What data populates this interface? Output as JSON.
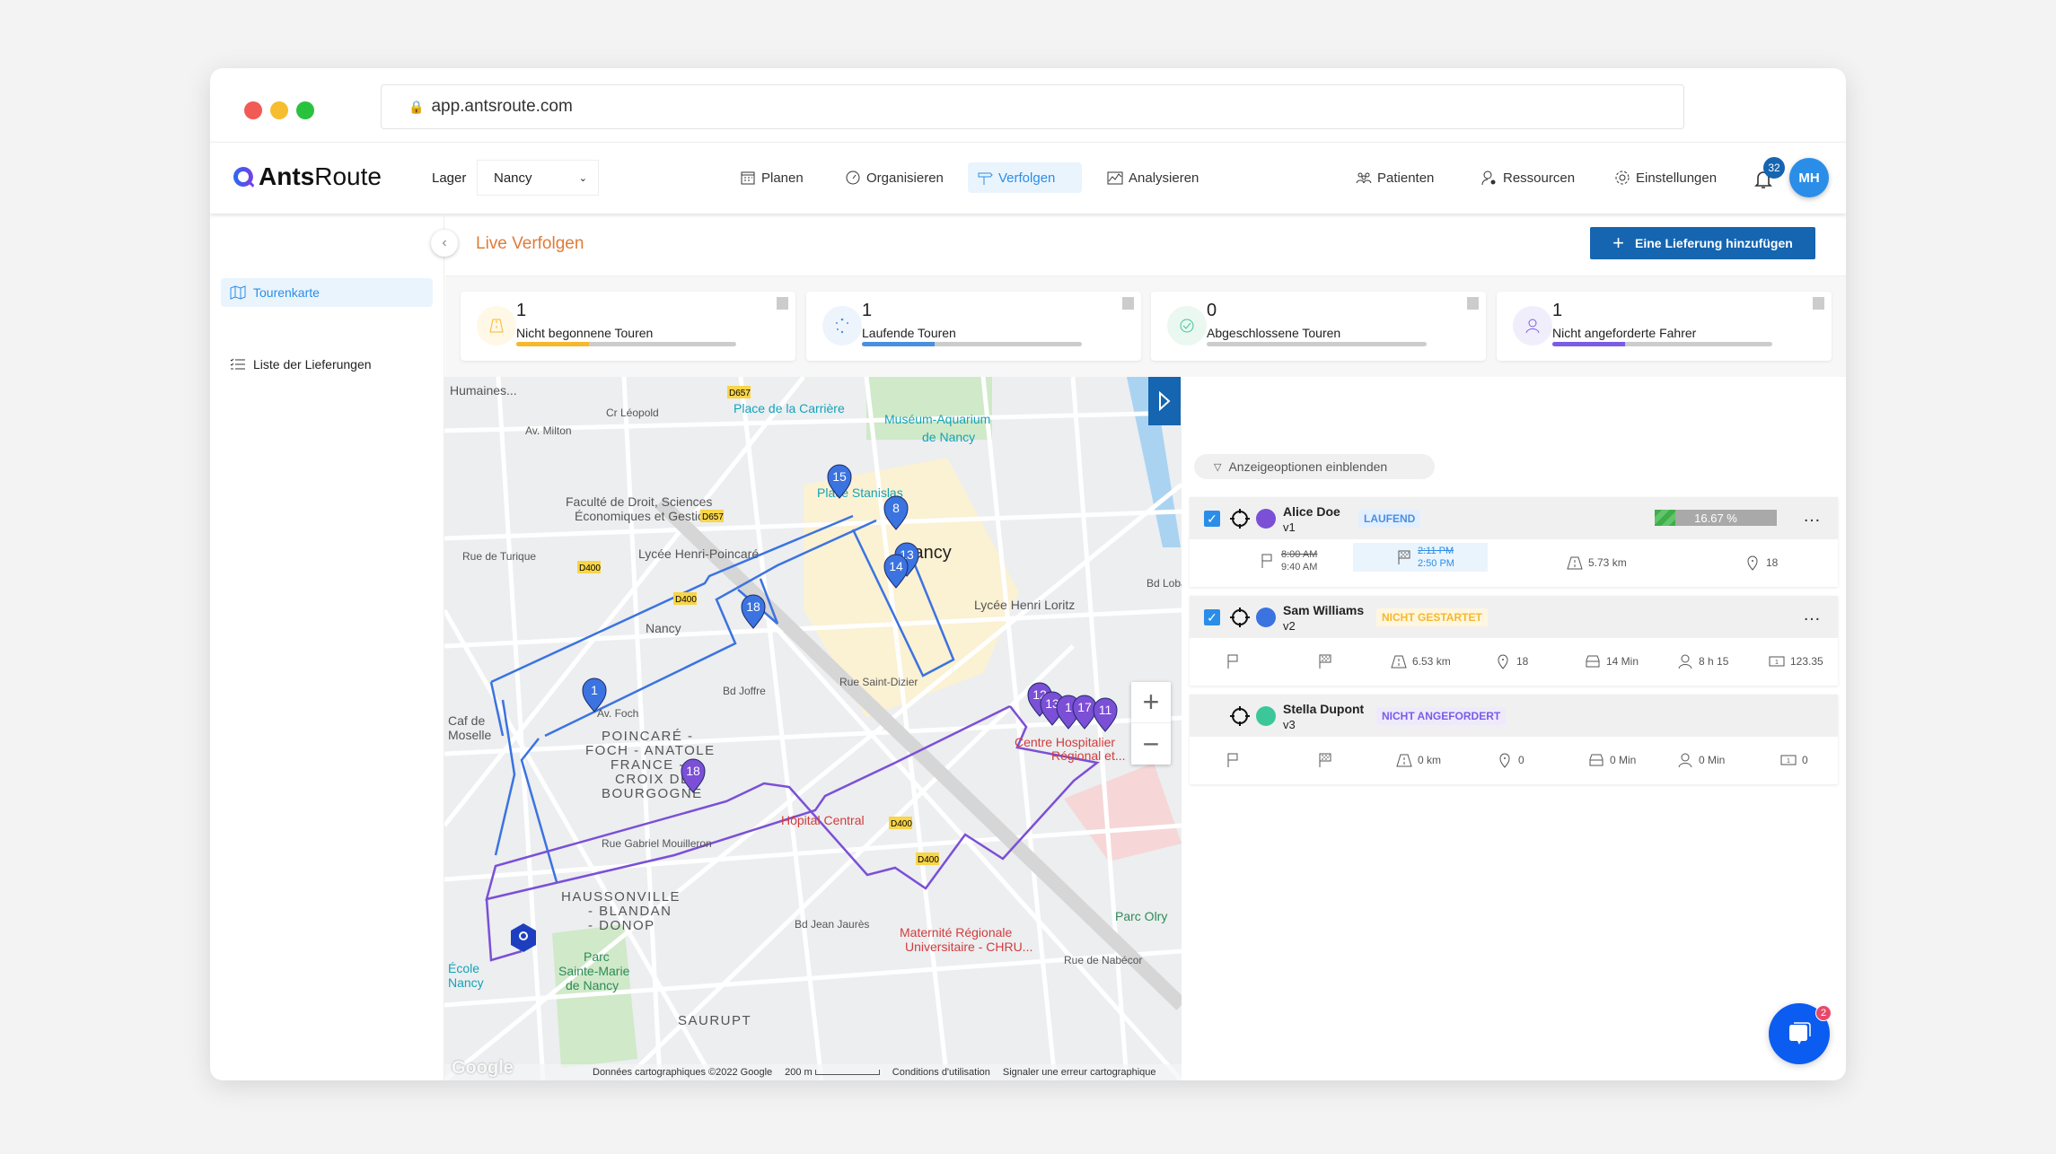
{
  "browser": {
    "url": "app.antsroute.com"
  },
  "header": {
    "logo": {
      "bold": "Ants",
      "light": "Route"
    },
    "lager_label": "Lager",
    "lager_value": "Nancy",
    "nav": [
      {
        "label": "Planen",
        "icon": "calendar-icon"
      },
      {
        "label": "Organisieren",
        "icon": "gauge-icon"
      },
      {
        "label": "Verfolgen",
        "icon": "signpost-icon",
        "active": true
      },
      {
        "label": "Analysieren",
        "icon": "chart-icon"
      }
    ],
    "right_nav": [
      {
        "label": "Patienten",
        "icon": "group-icon"
      },
      {
        "label": "Ressourcen",
        "icon": "user-gear-icon"
      },
      {
        "label": "Einstellungen",
        "icon": "gear-icon"
      }
    ],
    "notifications": "32",
    "avatar": "MH"
  },
  "sidebar": {
    "items": [
      {
        "label": "Tourenkarte",
        "icon": "map-icon",
        "active": true
      },
      {
        "label": "Liste der Lieferungen",
        "icon": "list-icon"
      }
    ]
  },
  "page": {
    "title": "Live Verfolgen",
    "add_button": "Eine Lieferung hinzufügen"
  },
  "colors": {
    "accent": "#1565b0",
    "title": "#e07b39",
    "alice": "#7b4fd6",
    "sam": "#3b73e0",
    "stella": "#3cc79a",
    "laufend_bg": "#e3efff",
    "nicht_gestartet": "#f5b82e",
    "nicht_angefordert": "#7a5ce6"
  },
  "stats": [
    {
      "value": "1",
      "label": "Nicht begonnene Touren",
      "progress": 33,
      "color": "#f5b82e"
    },
    {
      "value": "1",
      "label": "Laufende Touren",
      "progress": 33,
      "color": "#4a8fe0"
    },
    {
      "value": "0",
      "label": "Abgeschlossene Touren",
      "progress": 0,
      "color": "#3cc79a"
    },
    {
      "value": "1",
      "label": "Nicht angeforderte Fahrer",
      "progress": 33,
      "color": "#7a5ce6"
    }
  ],
  "filter": "Anzeigeoptionen einblenden",
  "tours": [
    {
      "name": "Alice Doe",
      "vehicle": "v1",
      "status": "LAUFEND",
      "checked": true,
      "progress": "16.67 %",
      "start_planned": "8:00 AM",
      "start_actual": "9:40 AM",
      "end_planned": "2:11 PM",
      "end_actual": "2:50 PM",
      "distance": "5.73 km",
      "stops": "18"
    },
    {
      "name": "Sam Williams",
      "vehicle": "v2",
      "status": "NICHT GESTARTET",
      "checked": true,
      "distance": "6.53 km",
      "stops": "18",
      "drive": "14 Min",
      "work": "8 h 15",
      "cost": "123.35"
    },
    {
      "name": "Stella Dupont",
      "vehicle": "v3",
      "status": "NICHT ANGEFORDERT",
      "checked": false,
      "distance": "0 km",
      "stops": "0",
      "drive": "0 Min",
      "work": "0 Min",
      "cost": "0"
    }
  ],
  "map": {
    "labels": [
      "Humaines...",
      "Place de la Carrière",
      "Muséum-Aquarium",
      "de Nancy",
      "Place Stanislas",
      "Faculté de Droit, Sciences",
      "Économiques et Gestion",
      "Nancy",
      "Lycée Henri-Poincaré",
      "Lycée Henri Loritz",
      "Nancy",
      "POINCARÉ -",
      "FOCH - ANATOLE",
      "FRANCE -",
      "CROIX DE",
      "BOURGOGNE",
      "HAUSSONVILLE",
      "- BLANDAN",
      "- DONOP",
      "Parc",
      "Sainte-Marie",
      "de Nancy",
      "Hôpital Central",
      "Maternité Régionale",
      "Universitaire - CHRU...",
      "Centre Hospitalier",
      "Régional et...",
      "Parc Olry",
      "SAURUPT",
      "Caf de",
      "Moselle",
      "École",
      "Nancy",
      "Bd Lobau",
      "Rue Saint-Dizier",
      "Bd Joffre",
      "Bd Jean Jaurès",
      "Rue de Nabécor",
      "Av. Milton",
      "Rue de Turique",
      "Cr Léopold",
      "Rue Gabriel Mouilleron",
      "Av. Foch",
      "D657",
      "D400",
      "D400",
      "D400",
      "D400",
      "D657"
    ],
    "blue_markers": [
      "15",
      "8",
      "13",
      "14",
      "18",
      "1"
    ],
    "purple_markers": [
      "12",
      "13",
      "1",
      "17",
      "11",
      "18"
    ],
    "zoom_in": "+",
    "zoom_out": "−",
    "attribution": "Données cartographiques ©2022 Google",
    "scale": "200 m",
    "terms": "Conditions d'utilisation",
    "report": "Signaler une erreur cartographique",
    "google": "Google"
  },
  "chat": {
    "badge": "2"
  }
}
